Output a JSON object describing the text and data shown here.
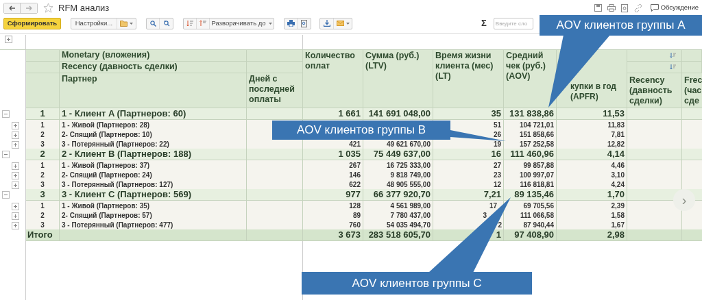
{
  "window": {
    "title": "RFM анализ",
    "discussion": "Обсуждение"
  },
  "toolbar": {
    "generate": "Сформировать",
    "settings": "Настройки...",
    "expand_to": "Разворачивать до",
    "sigma": "Σ",
    "search": {
      "placeholder": "Введите сло"
    }
  },
  "table": {
    "header": {
      "monetary": "Monetary (вложения)",
      "recency": "Recency (давность сделки)",
      "partner": "Партнер",
      "days": "Дней с последней оплаты",
      "columns": [
        "Количество оплат",
        "Сумма (руб.) (LTV)",
        "Время жизни клиента (мес) (LT)",
        "Средний чек (руб.) (AOV)",
        "купки в год (APFR)",
        "Recency (давность сделки)",
        "Frec (час сде"
      ]
    },
    "groups": [
      {
        "number": "1",
        "name": "1 - Клиент A (Партнеров: 60)",
        "expanded": true,
        "values": {
          "quantity": "1 661",
          "ltv": "141 691 048,00",
          "lt": "35",
          "aov": "131 838,86",
          "apfr": "11,53"
        },
        "rows": [
          {
            "number": "1",
            "name": "1 - Живой (Партнеров: 28)",
            "expanded": false,
            "values": {
              "lt": "51",
              "aov": "104 721,01",
              "apfr": "11,83"
            }
          },
          {
            "number": "2",
            "name": "2- Спящий (Партнеров: 10)",
            "expanded": false,
            "values": {
              "lt": "26",
              "aov": "151 858,66",
              "apfr": "7,81"
            }
          },
          {
            "number": "3",
            "name": "3 - Потерянный (Партнеров: 22)",
            "expanded": false,
            "values": {
              "quantity": "421",
              "ltv": "49 621 670,00",
              "lt": "19",
              "aov": "157 252,58",
              "apfr": "12,82"
            }
          }
        ]
      },
      {
        "number": "2",
        "name": "2 - Клиент B (Партнеров: 188)",
        "expanded": true,
        "values": {
          "quantity": "1 035",
          "ltv": "75 449 637,00",
          "lt": "16",
          "aov": "111 460,96",
          "apfr": "4,14"
        },
        "rows": [
          {
            "number": "1",
            "name": "1 - Живой (Партнеров: 37)",
            "expanded": false,
            "values": {
              "quantity": "267",
              "ltv": "16 725 333,00",
              "lt": "27",
              "aov": "99 857,88",
              "apfr": "4,46"
            }
          },
          {
            "number": "2",
            "name": "2- Спящий (Партнеров: 24)",
            "expanded": false,
            "values": {
              "quantity": "146",
              "ltv": "9 818 749,00",
              "lt": "23",
              "aov": "100 997,07",
              "apfr": "3,10"
            }
          },
          {
            "number": "3",
            "name": "3 - Потерянный (Партнеров: 127)",
            "expanded": false,
            "values": {
              "quantity": "622",
              "ltv": "48 905 555,00",
              "lt": "12",
              "aov": "116 818,81",
              "apfr": "4,24"
            }
          }
        ]
      },
      {
        "number": "3",
        "name": "3 - Клиент C (Партнеров: 569)",
        "expanded": true,
        "values": {
          "quantity": "977",
          "ltv": "66 377 920,70",
          "lt": "7,21",
          "aov": "89 135,46",
          "apfr": "1,70"
        },
        "rows": [
          {
            "number": "1",
            "name": "1 - Живой (Партнеров: 35)",
            "expanded": false,
            "values": {
              "quantity": "128",
              "ltv": "4 561 989,00",
              "lt": "17",
              "aov": "69 705,56",
              "apfr": "2,39"
            }
          },
          {
            "number": "2",
            "name": "2- Спящий (Партнеров: 57)",
            "expanded": false,
            "values": {
              "quantity": "89",
              "ltv": "7 780 437,00",
              "lt": "3",
              "aov": "111 066,58",
              "apfr": "1,58"
            }
          },
          {
            "number": "3",
            "name": "3 - Потерянный (Партнеров: 477)",
            "expanded": false,
            "values": {
              "quantity": "760",
              "ltv": "54 035 494,70",
              "lt": "2",
              "aov": "87 940,44",
              "apfr": "1,67"
            }
          }
        ]
      }
    ],
    "total": {
      "label": "Итого",
      "values": {
        "quantity": "3 673",
        "ltv": "283 518 605,70",
        "lt": "1",
        "aov": "97 408,90",
        "apfr": "2,98"
      }
    }
  },
  "scroll_button": "›",
  "callouts": [
    "AOV клиентов группы A",
    "AOV клиентов группы B",
    "AOV клиентов группы C"
  ]
}
